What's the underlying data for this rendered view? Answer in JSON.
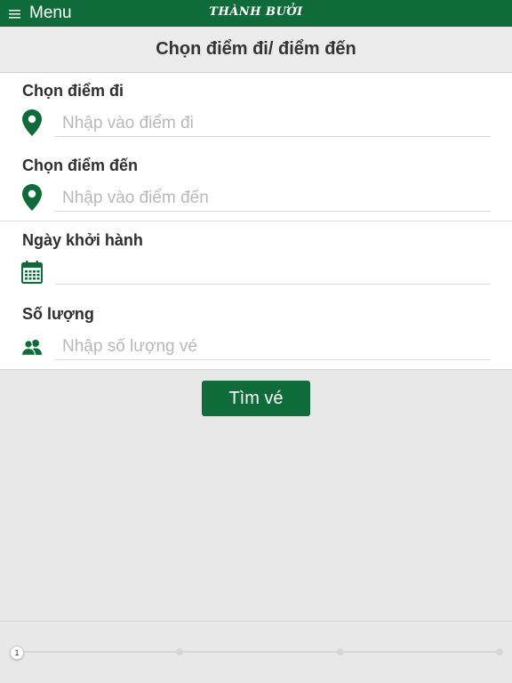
{
  "topbar": {
    "menu_label": "Menu",
    "logo_text": "THÀNH BƯỞI",
    "color": "#106b3a"
  },
  "header": {
    "title": "Chọn điểm đi/ điểm đến"
  },
  "form": {
    "origin": {
      "label": "Chọn điểm đi",
      "placeholder": "Nhập vào điểm đi",
      "value": "",
      "icon": "map-pin-icon"
    },
    "destination": {
      "label": "Chọn điểm đến",
      "placeholder": "Nhập vào điểm đến",
      "value": "",
      "icon": "map-pin-icon"
    },
    "departure_date": {
      "label": "Ngày khởi hành",
      "value": "",
      "icon": "calendar-icon"
    },
    "quantity": {
      "label": "Số lượng",
      "placeholder": "Nhập số lượng vé",
      "value": "",
      "icon": "users-icon"
    }
  },
  "actions": {
    "search_label": "Tìm vé"
  },
  "stepper": {
    "current_step": "1",
    "total_steps": 4
  }
}
